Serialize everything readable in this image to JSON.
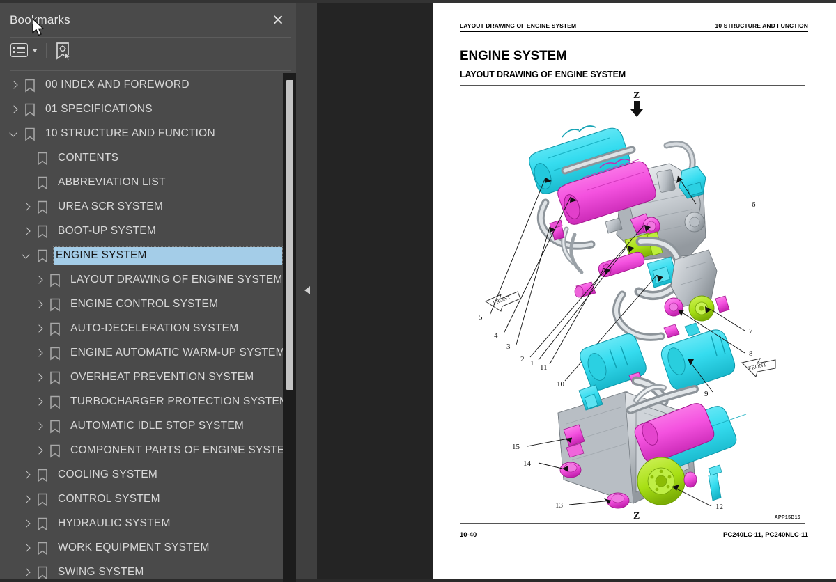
{
  "panel": {
    "title": "Bookmarks",
    "close_label": "✕",
    "toolbar": {
      "options_icon": "list-options-icon",
      "options_caret": "chevron-down-icon",
      "new_bookmark_icon": "new-bookmark-icon"
    }
  },
  "tree": [
    {
      "label": "00 INDEX AND FOREWORD",
      "indent": 0,
      "twisty": "right",
      "selected": false
    },
    {
      "label": "01 SPECIFICATIONS",
      "indent": 0,
      "twisty": "right",
      "selected": false
    },
    {
      "label": "10 STRUCTURE AND FUNCTION",
      "indent": 0,
      "twisty": "down",
      "selected": false
    },
    {
      "label": "CONTENTS",
      "indent": 1,
      "twisty": "none",
      "selected": false
    },
    {
      "label": "ABBREVIATION LIST",
      "indent": 1,
      "twisty": "none",
      "selected": false
    },
    {
      "label": "UREA SCR SYSTEM",
      "indent": 1,
      "twisty": "right",
      "selected": false
    },
    {
      "label": "BOOT-UP SYSTEM",
      "indent": 1,
      "twisty": "right",
      "selected": false
    },
    {
      "label": "ENGINE SYSTEM",
      "indent": 1,
      "twisty": "down",
      "selected": true
    },
    {
      "label": "LAYOUT DRAWING OF ENGINE SYSTEM",
      "indent": 2,
      "twisty": "right",
      "selected": false
    },
    {
      "label": "ENGINE CONTROL SYSTEM",
      "indent": 2,
      "twisty": "right",
      "selected": false
    },
    {
      "label": "AUTO-DECELERATION SYSTEM",
      "indent": 2,
      "twisty": "right",
      "selected": false
    },
    {
      "label": "ENGINE AUTOMATIC WARM-UP SYSTEM",
      "indent": 2,
      "twisty": "right",
      "selected": false
    },
    {
      "label": "OVERHEAT PREVENTION SYSTEM",
      "indent": 2,
      "twisty": "right",
      "selected": false
    },
    {
      "label": "TURBOCHARGER PROTECTION SYSTEM",
      "indent": 2,
      "twisty": "right",
      "selected": false
    },
    {
      "label": "AUTOMATIC IDLE STOP SYSTEM",
      "indent": 2,
      "twisty": "right",
      "selected": false
    },
    {
      "label": "COMPONENT PARTS OF ENGINE SYSTEM",
      "indent": 2,
      "twisty": "right",
      "selected": false
    },
    {
      "label": "COOLING SYSTEM",
      "indent": 1,
      "twisty": "right",
      "selected": false
    },
    {
      "label": "CONTROL SYSTEM",
      "indent": 1,
      "twisty": "right",
      "selected": false
    },
    {
      "label": "HYDRAULIC SYSTEM",
      "indent": 1,
      "twisty": "right",
      "selected": false
    },
    {
      "label": "WORK EQUIPMENT SYSTEM",
      "indent": 1,
      "twisty": "right",
      "selected": false
    },
    {
      "label": "SWING SYSTEM",
      "indent": 1,
      "twisty": "right",
      "selected": false
    }
  ],
  "document": {
    "running_head_left": "LAYOUT DRAWING OF ENGINE SYSTEM",
    "running_head_right": "10 STRUCTURE AND FUNCTION",
    "heading": "ENGINE SYSTEM",
    "subheading": "LAYOUT DRAWING OF ENGINE SYSTEM",
    "figure_code": "APP15B15",
    "page_number": "10-40",
    "model": "PC240LC-11, PC240NLC-11",
    "figure": {
      "view_labels": [
        "Z",
        "Z"
      ],
      "front_arrows": [
        "FRONT",
        "FRONT",
        "FRONT"
      ],
      "callouts_top": [
        "1",
        "2",
        "3",
        "4",
        "5",
        "6",
        "7",
        "8",
        "9",
        "10",
        "11"
      ],
      "callouts_bottom": [
        "12",
        "13",
        "14",
        "15"
      ]
    }
  },
  "colors": {
    "panel_bg": "#4a4a4a",
    "viewer_bg": "#242424",
    "selection": "#a4cde8",
    "text": "#d8d8d8",
    "part_cyan": "#42dff0",
    "part_magenta": "#f45ae0",
    "part_green": "#a8e020",
    "part_grey": "#b8bdc2"
  }
}
